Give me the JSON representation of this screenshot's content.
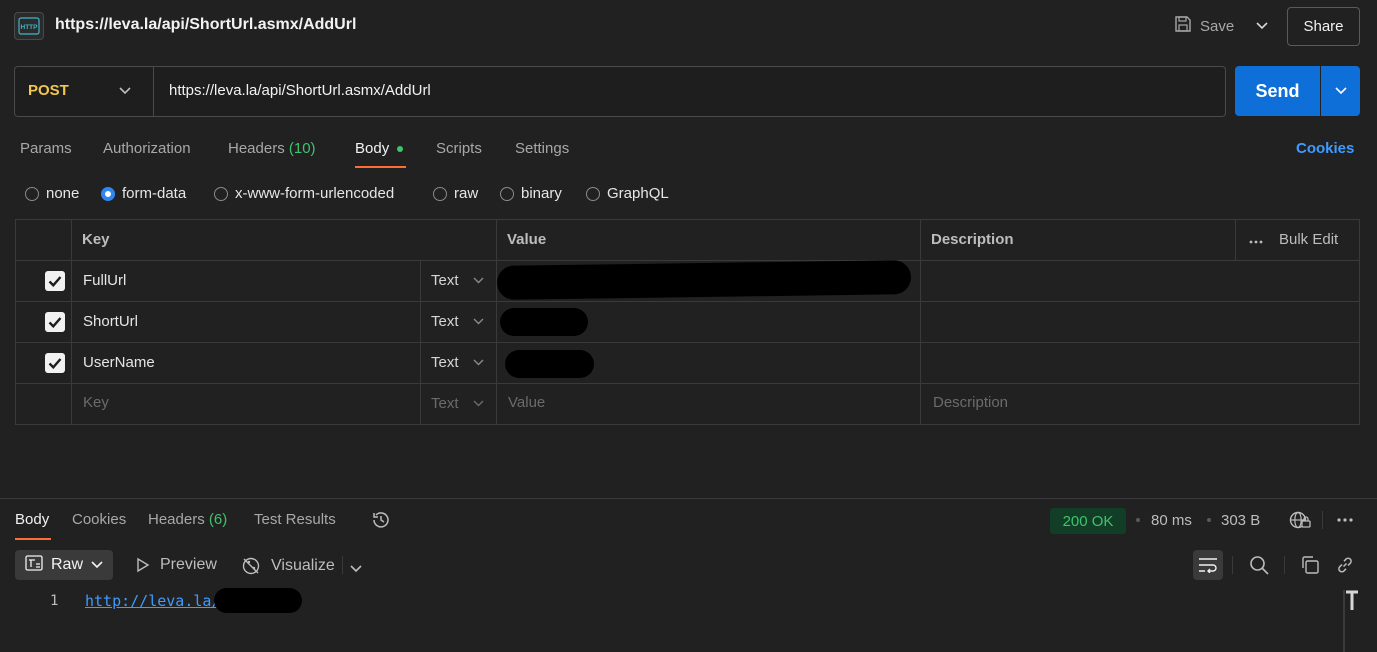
{
  "header": {
    "title": "https://leva.la/api/ShortUrl.asmx/AddUrl",
    "save_label": "Save",
    "share_label": "Share"
  },
  "request": {
    "method": "POST",
    "url": "https://leva.la/api/ShortUrl.asmx/AddUrl",
    "send_label": "Send"
  },
  "tabs": {
    "params": "Params",
    "authorization": "Authorization",
    "headers": "Headers",
    "headers_count": "(10)",
    "body": "Body",
    "scripts": "Scripts",
    "settings": "Settings",
    "cookies": "Cookies"
  },
  "body_modes": {
    "none": "none",
    "form_data": "form-data",
    "urlencoded": "x-www-form-urlencoded",
    "raw": "raw",
    "binary": "binary",
    "graphql": "GraphQL",
    "selected": "form-data"
  },
  "table": {
    "headers": {
      "key": "Key",
      "value": "Value",
      "description": "Description",
      "bulk_edit": "Bulk Edit"
    },
    "rows": [
      {
        "key": "FullUrl",
        "type": "Text",
        "checked": true
      },
      {
        "key": "ShortUrl",
        "type": "Text",
        "checked": true
      },
      {
        "key": "UserName",
        "type": "Text",
        "checked": true
      }
    ],
    "placeholder": {
      "key": "Key",
      "type": "Text",
      "value": "Value",
      "description": "Description"
    }
  },
  "response": {
    "tabs": {
      "body": "Body",
      "cookies": "Cookies",
      "headers": "Headers",
      "headers_count": "(6)",
      "test_results": "Test Results"
    },
    "status": "200 OK",
    "time": "80 ms",
    "size": "303 B",
    "format": "Raw",
    "preview": "Preview",
    "visualize": "Visualize",
    "line_number": "1",
    "content": "http://leva.la/"
  },
  "colors": {
    "accent": "#ff6c37",
    "send": "#0f6fd8",
    "method": "#f4c64e",
    "status_ok": "#3ec46d",
    "link": "#3e9bff"
  }
}
